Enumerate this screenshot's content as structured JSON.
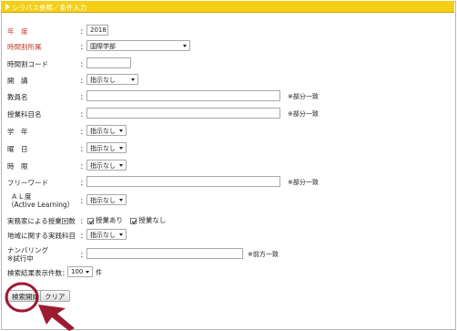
{
  "header": {
    "title": "シラバス参照／条件入力"
  },
  "form": {
    "year": {
      "label": "年　度",
      "value": "2018"
    },
    "timetable": {
      "label": "時間割所属",
      "value": "国際学部"
    },
    "code": {
      "label": "時間割コード",
      "value": ""
    },
    "course": {
      "label": "開　講",
      "value": "指示なし"
    },
    "teacher": {
      "label": "教員名",
      "value": "",
      "note": "※部分一致"
    },
    "subject": {
      "label": "授業科目名",
      "value": "",
      "note": "※部分一致"
    },
    "grade": {
      "label": "学　年",
      "value": "指示なし"
    },
    "weekday": {
      "label": "曜　日",
      "value": "指示なし"
    },
    "period": {
      "label": "時　限",
      "value": "指示なし"
    },
    "freeword": {
      "label": "フリーワード",
      "value": "",
      "note": "※部分一致"
    },
    "al": {
      "label_line1": "ＡＬ度",
      "label_line2": "（Active Learning）",
      "value": "指示なし"
    },
    "practical": {
      "label": "実務家による授業回数",
      "opt1": "授業あり",
      "opt2": "授業なし",
      "opt1_checked": true,
      "opt2_checked": true
    },
    "regional": {
      "label": "地域に関する実践科目",
      "value": "指示なし"
    },
    "numbering": {
      "label_line1": "ナンバリング",
      "label_line2": "※試行中",
      "value": "",
      "note": "※前方一致"
    },
    "results": {
      "label": "検索結果表示件数：",
      "value": "100",
      "unit": "件"
    }
  },
  "buttons": {
    "search": "検索開始",
    "clear": "クリア"
  }
}
